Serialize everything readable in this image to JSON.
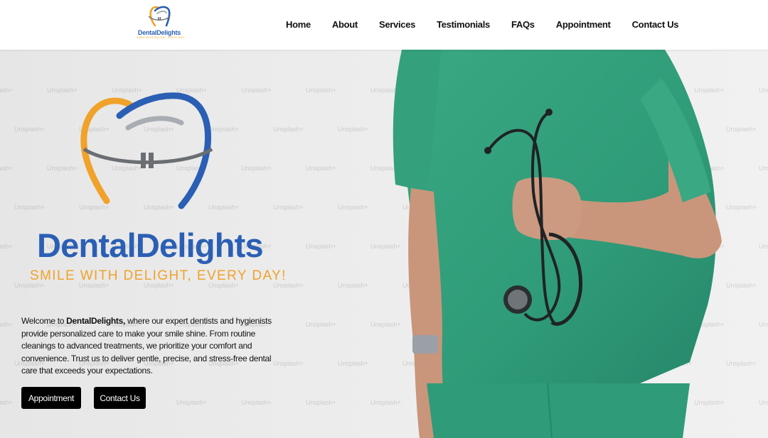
{
  "brand": {
    "name": "DentalDelights",
    "tagline": "SMILE WITH DELIGHT, EVERY DAY!"
  },
  "nav": {
    "items": [
      {
        "label": "Home"
      },
      {
        "label": "About"
      },
      {
        "label": "Services"
      },
      {
        "label": "Testimonials"
      },
      {
        "label": "FAQs"
      },
      {
        "label": "Appointment"
      },
      {
        "label": "Contact Us"
      }
    ]
  },
  "hero": {
    "intro_before": "Welcome to ",
    "intro_brand": "DentalDelights,",
    "intro_after": " where our expert dentists and hygienists provide personalized care to make your smile shine. From routine cleanings to advanced treatments, we prioritize your comfort and convenience. Trust us to deliver gentle, precise, and stress-free dental care that exceeds your expectations.",
    "buttons": {
      "appointment": "Appointment",
      "contact": "Contact Us"
    },
    "watermark_text": "Unsplash+"
  },
  "colors": {
    "brand_blue": "#2b5fb4",
    "brand_orange": "#f0a22a",
    "scrubs_teal": "#2f9b78",
    "button_black": "#000000"
  },
  "icons": {
    "logo": "tooth-with-braces-icon",
    "photo": "doctor-with-stethoscope-photo"
  }
}
